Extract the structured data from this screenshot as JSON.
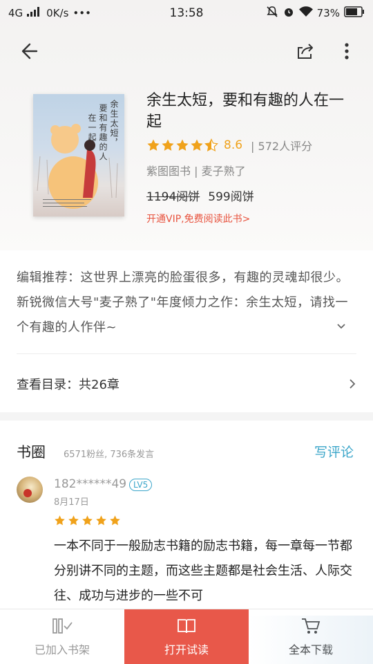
{
  "status_bar": {
    "network": "4G",
    "speed": "0K/s",
    "more": "•••",
    "time": "13:58",
    "battery": "73%"
  },
  "book": {
    "cover_text": [
      "余生太短，",
      "要和有趣的人",
      "在一起"
    ],
    "title": "余生太短，要和有趣的人在一起",
    "rating_stars": 4.5,
    "rating_score": "8.6",
    "rating_count": "| 572人评分",
    "publisher_author": "紫图图书 | 麦子熟了",
    "price_old": "1194阅饼",
    "price_new": "599阅饼",
    "vip_link": "开通VIP,免费阅读此书>"
  },
  "recommend": {
    "text": "编辑推荐：这世界上漂亮的脸蛋很多，有趣的灵魂却很少。新锐微信大号\"麦子熟了\"年度倾力之作：余生太短，请找一个有趣的人作伴~"
  },
  "toc": {
    "label": "查看目录：共26章"
  },
  "circle": {
    "title": "书圈",
    "stats": "6571粉丝, 736条发言",
    "write_review": "写评论"
  },
  "post": {
    "user": "182******49",
    "level": "LV5",
    "date": "8月17日",
    "stars": 5,
    "text": "一本不同于一般励志书籍的励志书籍，每一章每一节都分别讲不同的主题，而这些主题都是社会生活、人际交往、成功与进步的一些不可"
  },
  "bottom_bar": {
    "shelf_label": "已加入书架",
    "read_label": "打开试读",
    "download_label": "全本下载"
  },
  "colors": {
    "accent_red": "#e8584a",
    "star_orange": "#f0a21b",
    "link_blue": "#3aa5c9"
  }
}
